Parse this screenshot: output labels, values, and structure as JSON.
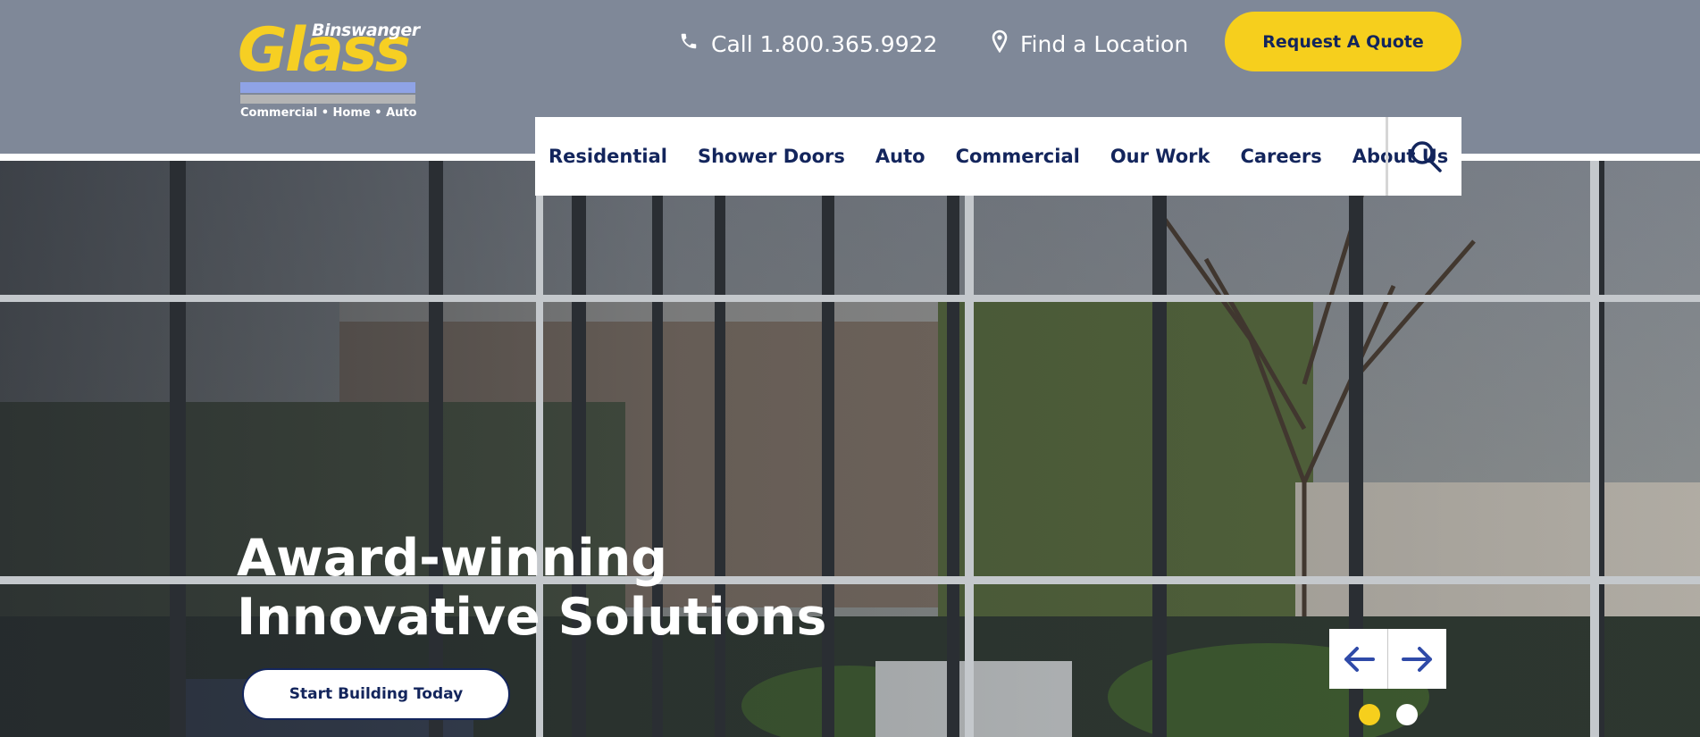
{
  "header": {
    "logo": {
      "brand_small": "Binswanger",
      "brand_big": "Glass",
      "tagline": "Commercial • Home • Auto"
    },
    "call_label": "Call 1.800.365.9922",
    "location_label": "Find a Location",
    "quote_button": "Request A Quote",
    "icons": {
      "phone": "phone-icon",
      "location": "map-pin-icon",
      "search": "search-icon"
    }
  },
  "nav": {
    "items": [
      {
        "label": "Residential"
      },
      {
        "label": "Shower Doors"
      },
      {
        "label": "Auto"
      },
      {
        "label": "Commercial"
      },
      {
        "label": "Our Work"
      },
      {
        "label": "Careers"
      },
      {
        "label": "About Us"
      }
    ]
  },
  "hero": {
    "title_line1": "Award-winning",
    "title_line2": "Innovative Solutions",
    "cta_label": "Start Building Today",
    "carousel": {
      "slide_count": 2,
      "active_slide": 1
    }
  },
  "colors": {
    "header_bg": "#7f8898",
    "accent_yellow": "#f6cf1d",
    "navy": "#13255c",
    "arrow_blue": "#2f4aa8"
  }
}
